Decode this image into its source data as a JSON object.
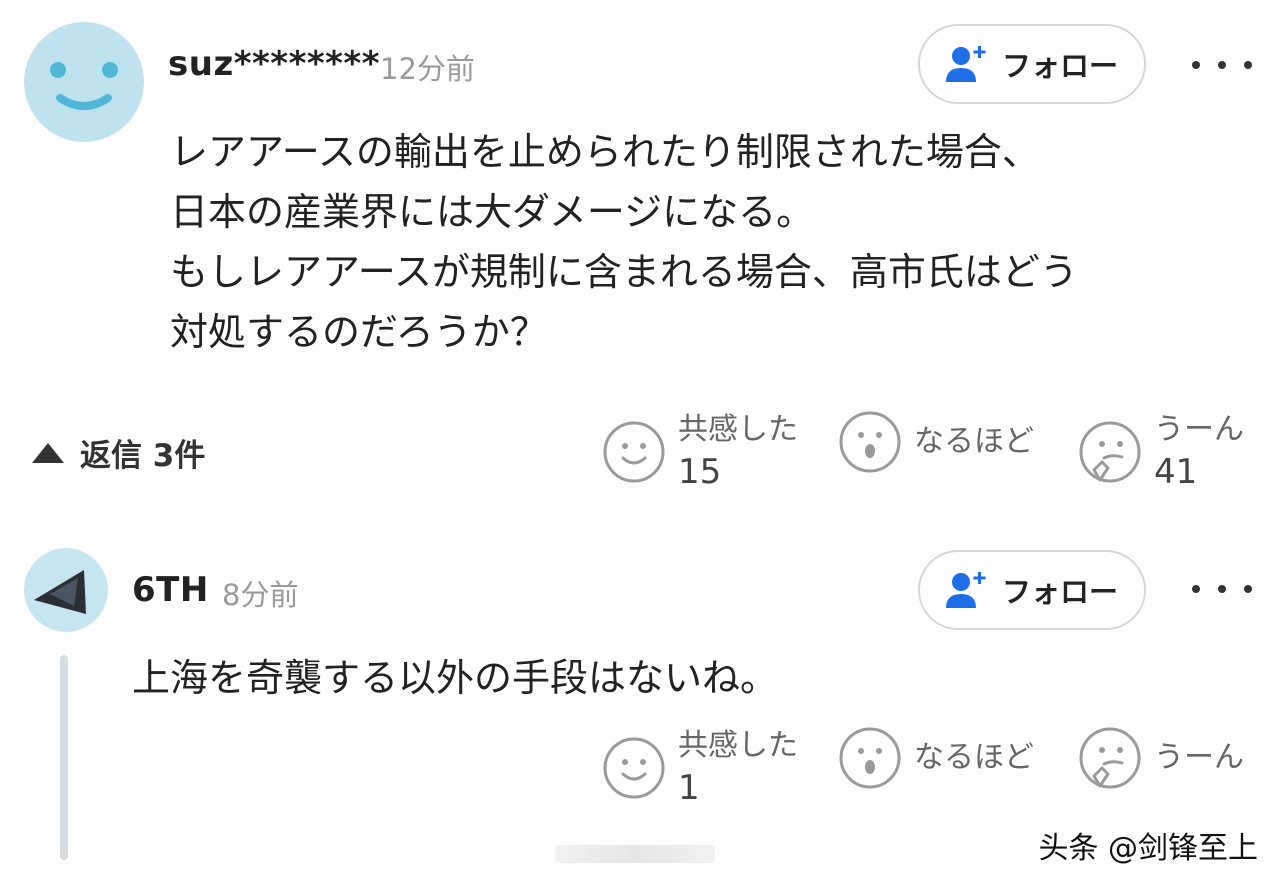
{
  "comments": [
    {
      "username": "suz********",
      "time": "12分前",
      "follow_label": "フォロー",
      "lines": [
        "レアアースの輸出を止められたり制限された場合、",
        "日本の産業界には大ダメージになる。",
        "もしレアアースが規制に含まれる場合、高市氏はどう",
        "対処するのだろうか？"
      ],
      "replies_label": "返信 3件",
      "reactions": [
        {
          "label": "共感した",
          "count": "15"
        },
        {
          "label": "なるほど",
          "count": ""
        },
        {
          "label": "うーん",
          "count": "41"
        }
      ]
    },
    {
      "username": "6TH",
      "time": "8分前",
      "follow_label": "フォロー",
      "lines": [
        "上海を奇襲する以外の手段はないね。"
      ],
      "reactions": [
        {
          "label": "共感した",
          "count": "1"
        },
        {
          "label": "なるほど",
          "count": ""
        },
        {
          "label": "うーん",
          "count": ""
        }
      ]
    }
  ],
  "watermark": "头条 @剑锋至上",
  "colors": {
    "accent_blue": "#1e6ee8",
    "avatar_bg_1": "#bfe3ee",
    "avatar_bg_2": "#c5e6f0",
    "reaction_gray": "#9a9a9a"
  },
  "icons": {
    "follow": "add-user-icon",
    "more": "more-dots-icon",
    "replies_toggle": "triangle-up-icon",
    "empathy": "smile-face-icon",
    "insight": "surprised-face-icon",
    "hmm": "thinking-face-icon"
  }
}
